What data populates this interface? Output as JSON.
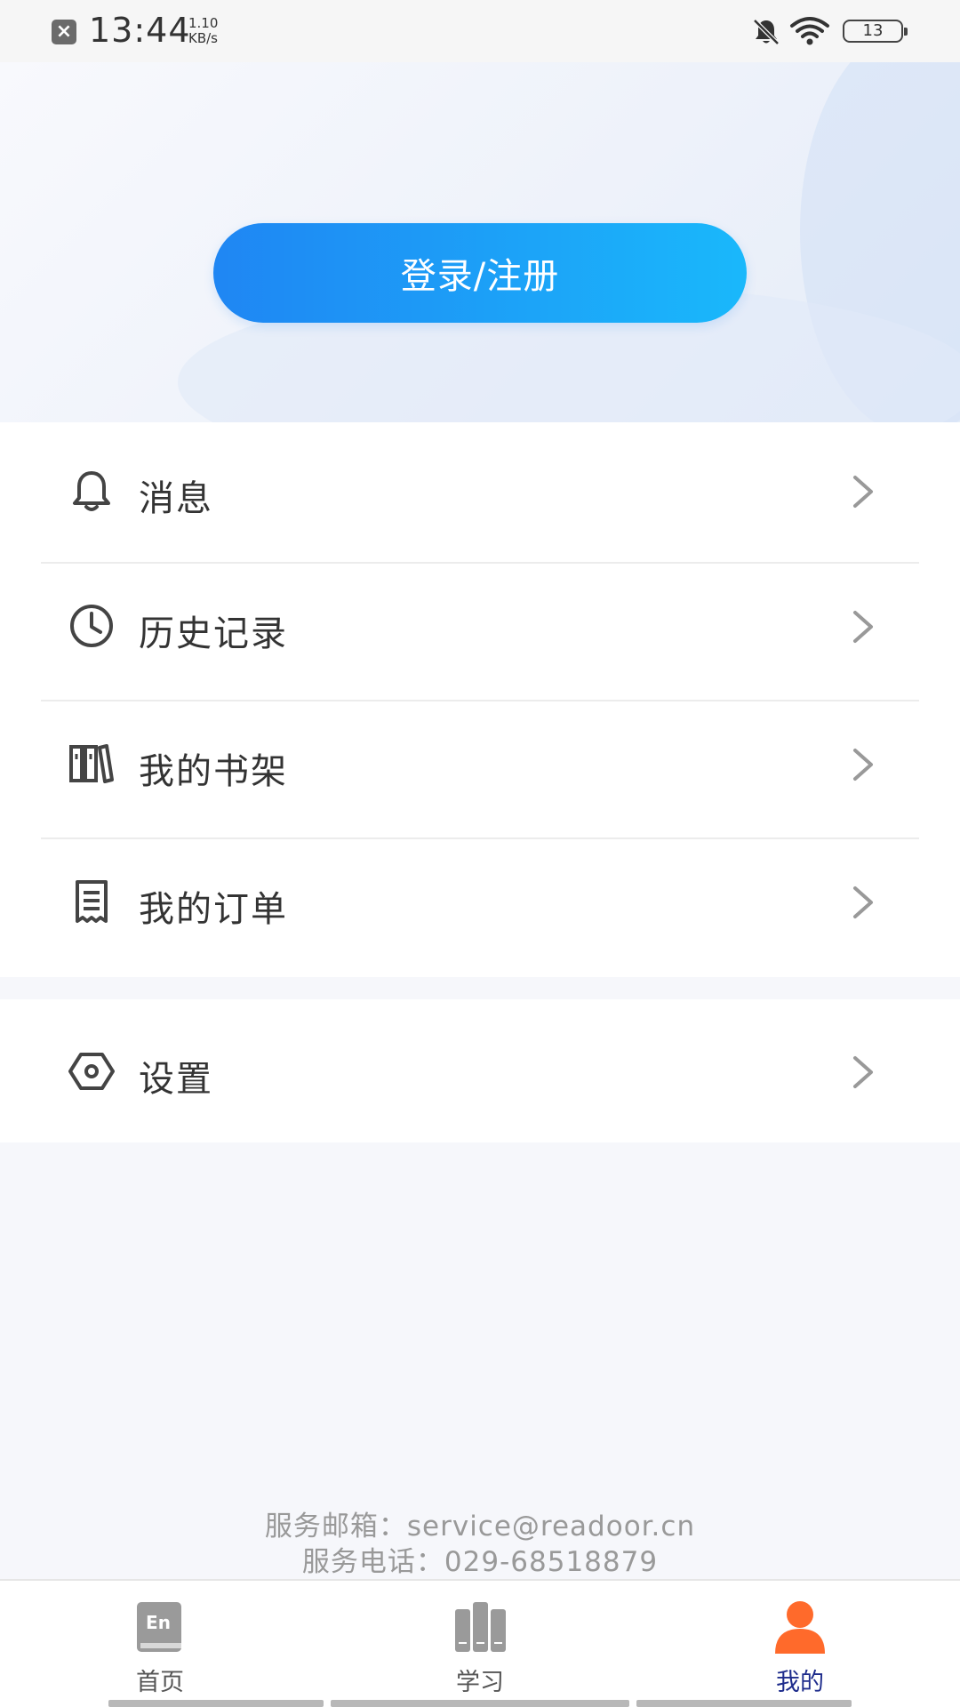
{
  "status_bar": {
    "time": "13:44",
    "speed_value": "1.10",
    "speed_unit": "KB/s",
    "battery": "13",
    "icons": [
      "close-notification-icon",
      "bell-muted-icon",
      "wifi-icon",
      "battery-icon"
    ]
  },
  "header": {
    "login_label": "登录/注册"
  },
  "menu": {
    "items": [
      {
        "label": "消息",
        "icon": "bell-icon"
      },
      {
        "label": "历史记录",
        "icon": "clock-icon"
      },
      {
        "label": "我的书架",
        "icon": "bookshelf-icon"
      },
      {
        "label": "我的订单",
        "icon": "order-icon"
      }
    ],
    "settings": {
      "label": "设置",
      "icon": "settings-hexagon-icon"
    }
  },
  "service": {
    "email_line": "服务邮箱：service@readoor.cn",
    "phone_line": "服务电话：029-68518879"
  },
  "tab_bar": {
    "tabs": [
      {
        "label": "首页",
        "icon": "en-book-icon",
        "active": false
      },
      {
        "label": "学习",
        "icon": "books-icon",
        "active": false
      },
      {
        "label": "我的",
        "icon": "person-icon",
        "active": true
      }
    ],
    "active_color": "#ff6a2b",
    "active_label_color": "#1e2c8c"
  },
  "colors": {
    "accent_start": "#1f86f3",
    "accent_end": "#1ab8fb"
  }
}
